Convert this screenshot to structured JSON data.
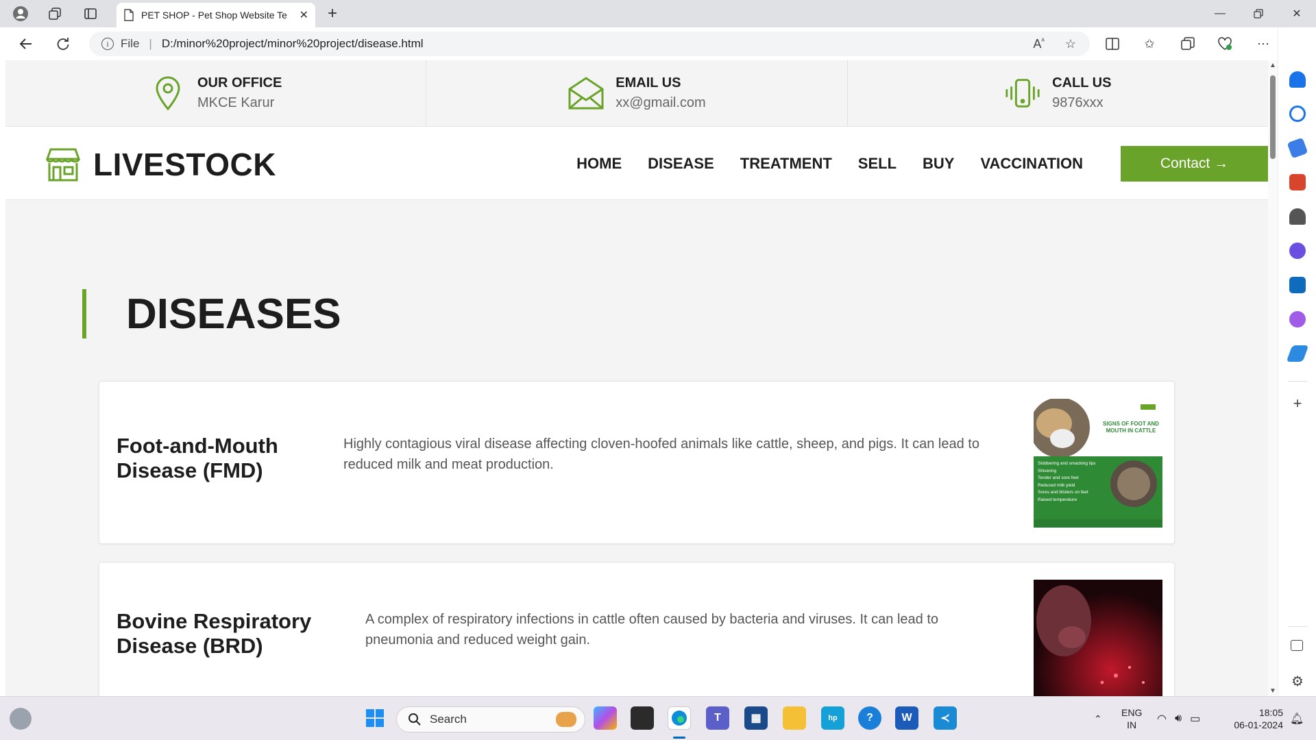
{
  "browser": {
    "tab_title": "PET SHOP - Pet Shop Website Te",
    "file_label": "File",
    "url": "D:/minor%20project/minor%20project/disease.html"
  },
  "topbar": {
    "office": {
      "heading": "OUR OFFICE",
      "value": "MKCE Karur"
    },
    "email": {
      "heading": "EMAIL US",
      "value": "xx@gmail.com"
    },
    "call": {
      "heading": "CALL US",
      "value": "9876xxx"
    }
  },
  "navbar": {
    "brand": "LIVESTOCK",
    "menu": [
      "HOME",
      "DISEASE",
      "TREATMENT",
      "SELL",
      "BUY",
      "VACCINATION"
    ],
    "contact_label": "Contact →"
  },
  "page": {
    "section_title": "DISEASES",
    "diseases": [
      {
        "name": "Foot-and-Mouth Disease (FMD)",
        "description": "Highly contagious viral disease affecting cloven-hoofed animals like cattle, sheep, and pigs. It can lead to reduced milk and meat production.",
        "image": {
          "title": "SIGNS OF FOOT AND MOUTH IN CATTLE",
          "signs": [
            "Slobbering and smacking lips",
            "Shivering",
            "Tender and sore feet",
            "Reduced milk yield",
            "Sores and blisters on feet",
            "Raised temperature"
          ]
        }
      },
      {
        "name": "Bovine Respiratory Disease (BRD)",
        "description": "A complex of respiratory infections in cattle often caused by bacteria and viruses. It can lead to pneumonia and reduced weight gain."
      }
    ]
  },
  "taskbar": {
    "search_label": "Search",
    "lang_primary": "ENG",
    "lang_secondary": "IN",
    "time": "18:05",
    "date": "06-01-2024"
  },
  "colors": {
    "accent": "#6aa329",
    "heading": "#1d1d1d"
  }
}
